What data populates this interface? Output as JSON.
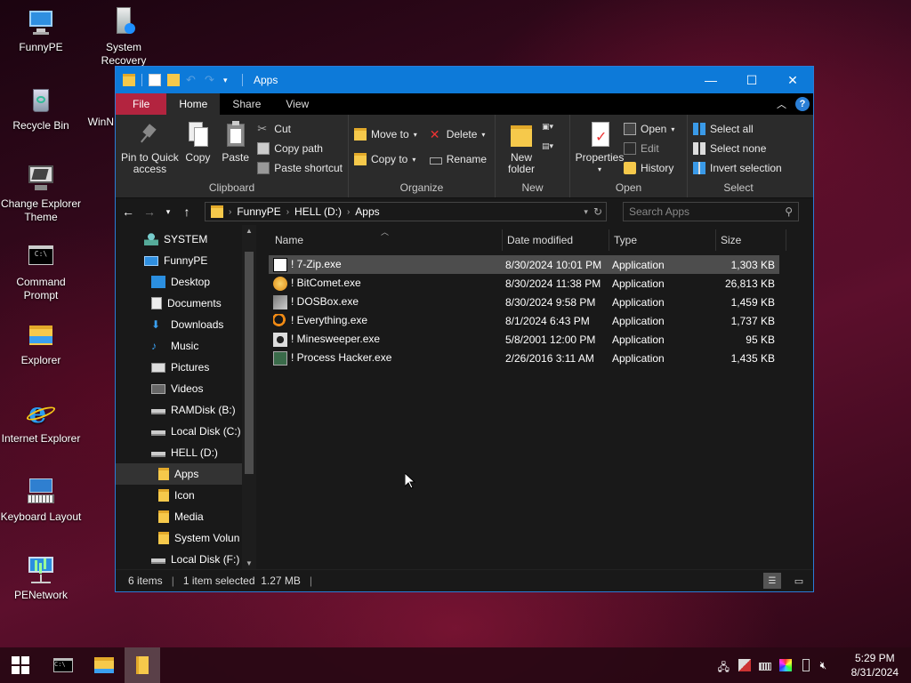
{
  "desktop": {
    "icons": [
      {
        "label": "FunnyPE",
        "icon": "pc-icon"
      },
      {
        "label": "System Recovery",
        "icon": "recovery-icon"
      },
      {
        "label": "Recycle Bin",
        "icon": "recycle-bin-icon"
      },
      {
        "label": "WinN",
        "icon": "app-icon"
      },
      {
        "label": "Change Explorer Theme",
        "icon": "theme-icon"
      },
      {
        "label": "Command Prompt",
        "icon": "cmd-icon"
      },
      {
        "label": "Explorer",
        "icon": "folder-icon"
      },
      {
        "label": "Internet Explorer",
        "icon": "ie-icon"
      },
      {
        "label": "Keyboard Layout",
        "icon": "keyboard-icon"
      },
      {
        "label": "PENetwork",
        "icon": "network-icon"
      }
    ]
  },
  "window": {
    "title": "Apps",
    "tabs": [
      "File",
      "Home",
      "Share",
      "View"
    ],
    "active_tab": "Home",
    "ribbon": {
      "clipboard": {
        "label": "Clipboard",
        "pin": "Pin to Quick access",
        "copy": "Copy",
        "paste": "Paste",
        "cut": "Cut",
        "copy_path": "Copy path",
        "paste_shortcut": "Paste shortcut"
      },
      "organize": {
        "label": "Organize",
        "move_to": "Move to",
        "copy_to": "Copy to",
        "delete": "Delete",
        "rename": "Rename"
      },
      "new": {
        "label": "New",
        "new_folder": "New folder"
      },
      "open": {
        "label": "Open",
        "properties": "Properties",
        "open": "Open",
        "edit": "Edit",
        "history": "History"
      },
      "select": {
        "label": "Select",
        "select_all": "Select all",
        "select_none": "Select none",
        "invert": "Invert selection"
      }
    },
    "address": {
      "crumbs": [
        "FunnyPE",
        "HELL (D:)",
        "Apps"
      ]
    },
    "search": {
      "placeholder": "Search Apps"
    },
    "nav_tree": [
      {
        "label": "SYSTEM",
        "icon": "user-icon",
        "indent": 0
      },
      {
        "label": "FunnyPE",
        "icon": "pc-icon",
        "indent": 0
      },
      {
        "label": "Desktop",
        "icon": "desktop-icon",
        "indent": 1
      },
      {
        "label": "Documents",
        "icon": "documents-icon",
        "indent": 1
      },
      {
        "label": "Downloads",
        "icon": "downloads-icon",
        "indent": 1
      },
      {
        "label": "Music",
        "icon": "music-icon",
        "indent": 1
      },
      {
        "label": "Pictures",
        "icon": "pictures-icon",
        "indent": 1
      },
      {
        "label": "Videos",
        "icon": "videos-icon",
        "indent": 1
      },
      {
        "label": "RAMDisk (B:)",
        "icon": "drive-icon",
        "indent": 1
      },
      {
        "label": "Local Disk (C:)",
        "icon": "drive-icon",
        "indent": 1
      },
      {
        "label": "HELL (D:)",
        "icon": "drive-icon",
        "indent": 1
      },
      {
        "label": "Apps",
        "icon": "folder-icon",
        "indent": 2,
        "selected": true
      },
      {
        "label": "Icon",
        "icon": "folder-icon",
        "indent": 2
      },
      {
        "label": "Media",
        "icon": "folder-icon",
        "indent": 2
      },
      {
        "label": "System Volun",
        "icon": "folder-icon",
        "indent": 2
      },
      {
        "label": "Local Disk (F:)",
        "icon": "drive-icon",
        "indent": 1
      }
    ],
    "columns": {
      "name": "Name",
      "date": "Date modified",
      "type": "Type",
      "size": "Size"
    },
    "files": [
      {
        "name": "! 7-Zip.exe",
        "date": "8/30/2024 10:01 PM",
        "type": "Application",
        "size": "1,303 KB",
        "icon": "7zip-icon",
        "selected": true
      },
      {
        "name": "! BitComet.exe",
        "date": "8/30/2024 11:38 PM",
        "type": "Application",
        "size": "26,813 KB",
        "icon": "bitcomet-icon"
      },
      {
        "name": "! DOSBox.exe",
        "date": "8/30/2024 9:58 PM",
        "type": "Application",
        "size": "1,459 KB",
        "icon": "dosbox-icon"
      },
      {
        "name": "! Everything.exe",
        "date": "8/1/2024 6:43 PM",
        "type": "Application",
        "size": "1,737 KB",
        "icon": "everything-icon"
      },
      {
        "name": "! Minesweeper.exe",
        "date": "5/8/2001 12:00 PM",
        "type": "Application",
        "size": "95 KB",
        "icon": "minesweeper-icon"
      },
      {
        "name": "! Process Hacker.exe",
        "date": "2/26/2016 3:11 AM",
        "type": "Application",
        "size": "1,435 KB",
        "icon": "processhacker-icon"
      }
    ],
    "status": {
      "count": "6 items",
      "selected": "1 item selected  1.27 MB"
    }
  },
  "taskbar": {
    "time": "5:29 PM",
    "date": "8/31/2024"
  },
  "colors": {
    "titlebar": "#0d7ad9",
    "file_tab": "#b3243f",
    "ribbon": "#2b2b2b",
    "background": "#191919"
  }
}
